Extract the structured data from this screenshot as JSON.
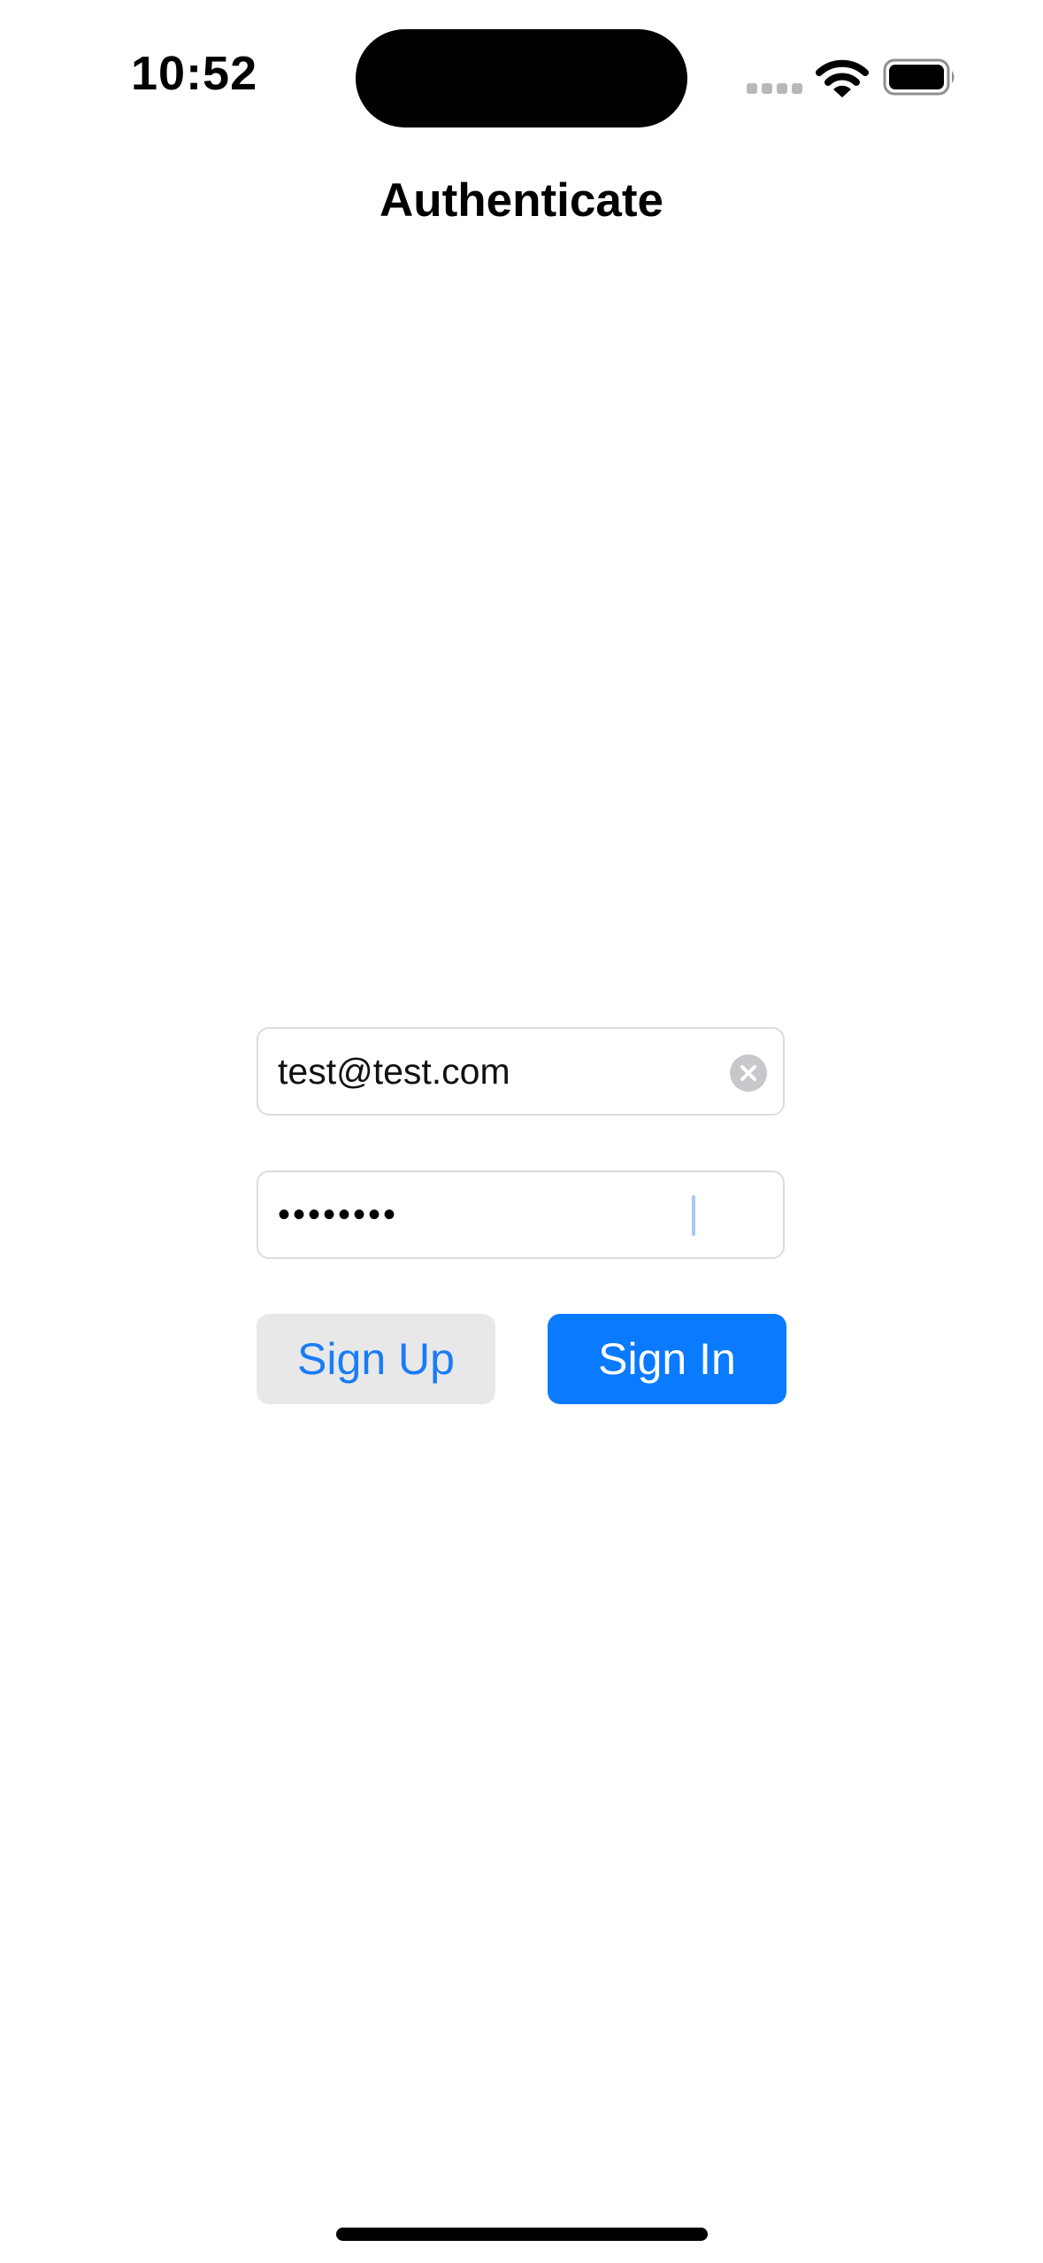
{
  "status_bar": {
    "time": "10:52"
  },
  "nav": {
    "title": "Authenticate"
  },
  "form": {
    "email": {
      "value": "test@test.com"
    },
    "password": {
      "masked_value": "••••••••"
    }
  },
  "buttons": {
    "sign_up_label": "Sign Up",
    "sign_in_label": "Sign In"
  },
  "colors": {
    "accent": "#0a7aff",
    "link_text": "#1a7cf5",
    "secondary_button_bg": "#e8e8e8",
    "field_border": "#dcdcdc"
  },
  "icons": {
    "wifi": "wifi-icon",
    "battery": "battery-icon",
    "signal": "cellular-signal-icon",
    "clear": "clear-text-icon"
  }
}
